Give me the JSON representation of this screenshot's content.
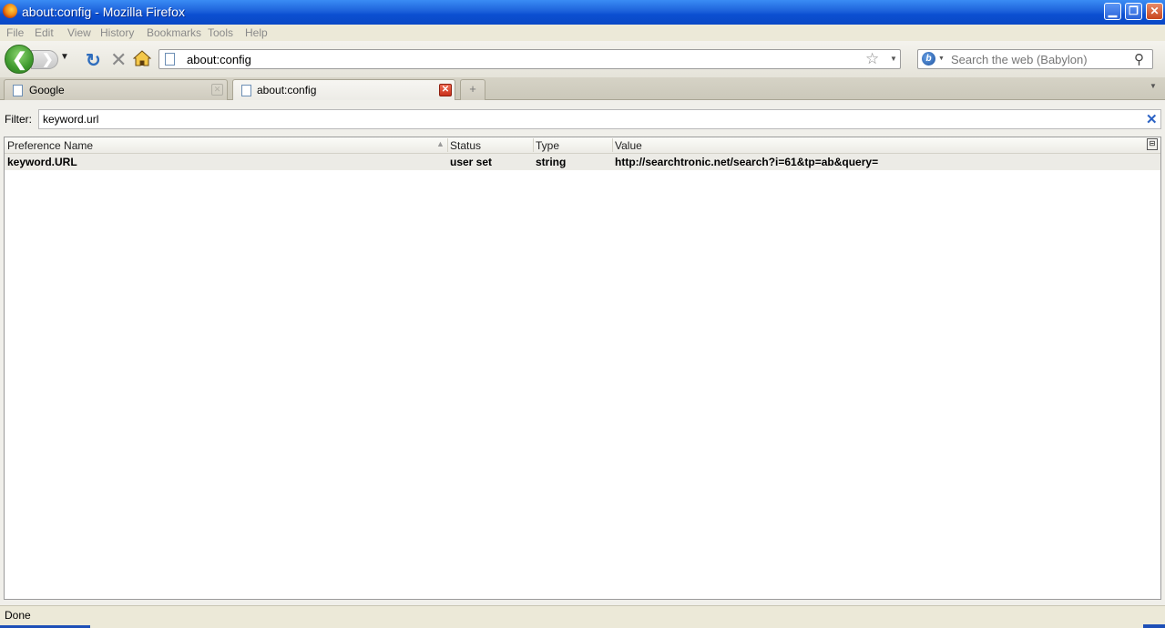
{
  "window": {
    "title": "about:config - Mozilla Firefox",
    "minimize_glyph": "▁",
    "maximize_glyph": "❐",
    "close_glyph": "✕"
  },
  "menu": {
    "items": [
      {
        "label": "File"
      },
      {
        "label": "Edit"
      },
      {
        "label": "View"
      },
      {
        "label": "History"
      },
      {
        "label": "Bookmarks"
      },
      {
        "label": "Tools"
      },
      {
        "label": "Help"
      }
    ]
  },
  "navbar": {
    "back_glyph": "❮",
    "forward_glyph": "❯",
    "history_dropdown_glyph": "▼",
    "reload_glyph": "↻",
    "stop_glyph": "✕",
    "url": "about:config",
    "star_glyph": "☆",
    "url_dropdown_glyph": "▼",
    "search_engine_letter": "b",
    "search_engine_dropdown_glyph": "▼",
    "search_placeholder": "Search the web (Babylon)",
    "search_go_glyph": "⚲"
  },
  "tabs": [
    {
      "label": "Google",
      "active": false,
      "close_glyph": "✕"
    },
    {
      "label": "about:config",
      "active": true,
      "close_glyph": "✕"
    }
  ],
  "tabbar": {
    "new_tab_glyph": "+",
    "list_all_tabs_glyph": "▼"
  },
  "config": {
    "filter_label": "Filter:",
    "filter_value": "keyword.url",
    "filter_clear_glyph": "✕",
    "columns": [
      "Preference Name",
      "Status",
      "Type",
      "Value"
    ],
    "sort_glyph": "▲",
    "column_picker_glyph": "⊟",
    "rows": [
      {
        "name": "keyword.URL",
        "status": "user set",
        "type": "string",
        "value": "http://searchtronic.net/search?i=61&tp=ab&query="
      }
    ]
  },
  "statusbar": {
    "text": "Done"
  },
  "colors": {
    "titlebar": "#0a48c6",
    "menubar_bg": "#ece9d8",
    "selected_row": "#ecebe6",
    "close_button": "#c9301b"
  }
}
